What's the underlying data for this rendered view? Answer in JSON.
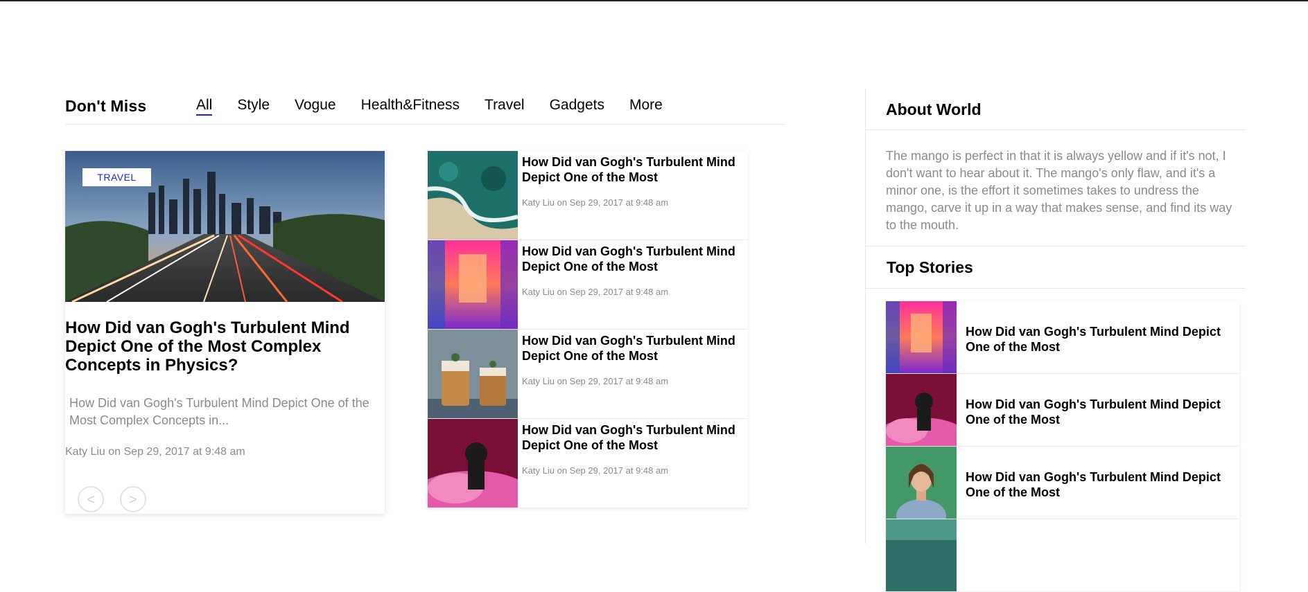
{
  "dont_miss": {
    "title": "Don't Miss",
    "tabs": [
      "All",
      "Style",
      "Vogue",
      "Health&Fitness",
      "Travel",
      "Gadgets",
      "More"
    ],
    "active_tab": "All",
    "accent_color": "#1a1aff"
  },
  "featured": {
    "tag": "TRAVEL",
    "title": "How Did van Gogh's Turbulent Mind Depict One of the Most Complex Concepts in Physics?",
    "excerpt": "How Did van Gogh's Turbulent Mind Depict One of the Most Complex Concepts in...",
    "meta": "Katy Liu on Sep 29, 2017 at 9:48 am",
    "prev_label": "<",
    "next_label": ">"
  },
  "articles": [
    {
      "title": "How Did van Gogh's Turbulent Mind Depict One of the Most",
      "meta": "Katy Liu on Sep 29, 2017 at 9:48 am",
      "image": "aerial-coast"
    },
    {
      "title": "How Did van Gogh's Turbulent Mind Depict One of the Most",
      "meta": "Katy Liu on Sep 29, 2017 at 9:48 am",
      "image": "neon-corridor"
    },
    {
      "title": "How Did van Gogh's Turbulent Mind Depict One of the Most",
      "meta": "Katy Liu on Sep 29, 2017 at 9:48 am",
      "image": "dessert-jars"
    },
    {
      "title": "How Did van Gogh's Turbulent Mind Depict One of the Most",
      "meta": "Katy Liu on Sep 29, 2017 at 9:48 am",
      "image": "pink-smoke-figure"
    }
  ],
  "sidebar": {
    "about_title": "About World",
    "about_text": "The mango is perfect in that it is always yellow and if it's not, I don't want to hear about it. The mango's only flaw, and it's a minor one, is the effort it sometimes takes to undress the mango, carve it up in a way that makes sense, and find its way to the mouth.",
    "top_stories_title": "Top Stories",
    "top_stories": [
      {
        "title": "How Did van Gogh's Turbulent Mind Depict One of the Most",
        "image": "neon-corridor"
      },
      {
        "title": "How Did van Gogh's Turbulent Mind Depict One of the Most",
        "image": "pink-smoke-figure"
      },
      {
        "title": "How Did van Gogh's Turbulent Mind Depict One of the Most",
        "image": "woman-portrait"
      },
      {
        "title": "",
        "image": "green-teal"
      }
    ]
  }
}
